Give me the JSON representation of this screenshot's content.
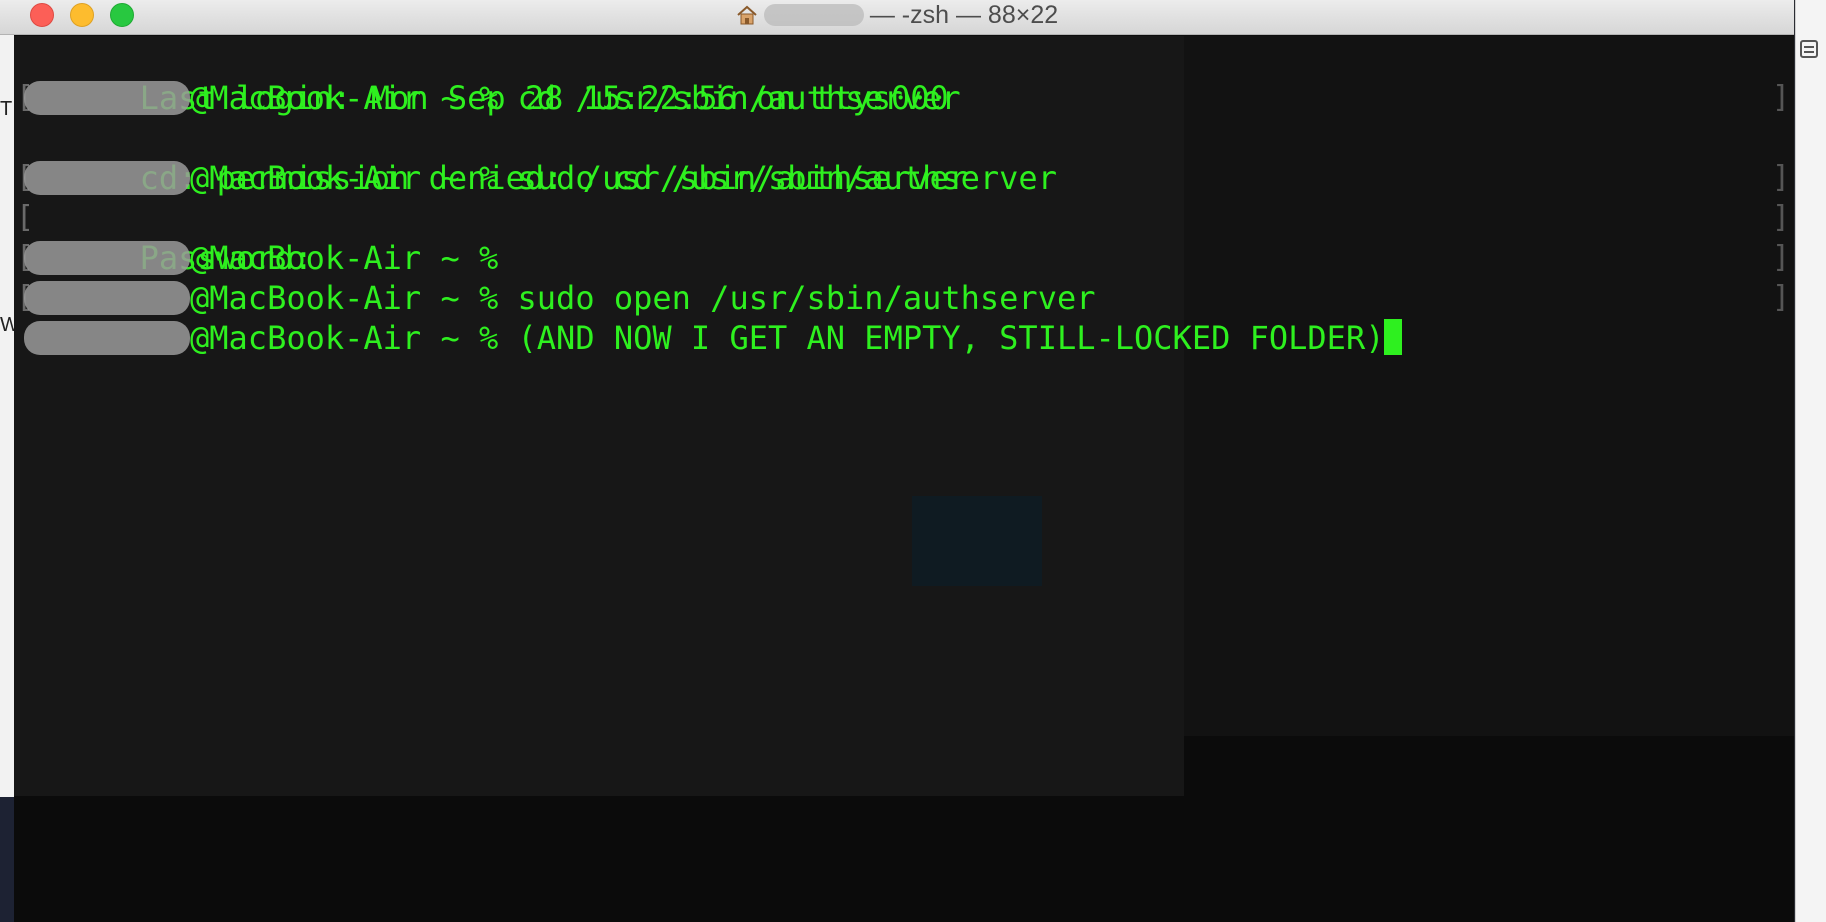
{
  "window": {
    "title": "— -zsh — 88×22",
    "icon": "home-icon"
  },
  "colors": {
    "terminal_background": "#0b0b0b",
    "terminal_text": "#2ef01f",
    "titlebar": "#e3e3e3"
  },
  "terminal": {
    "lines": [
      {
        "prompt": "",
        "text": "Last login: Mon Sep 28 15:22:56 on ttys000"
      },
      {
        "prompt": "@MacBook-Air ~ % ",
        "text": "cd /usr/sbin/authserver"
      },
      {
        "prompt": "",
        "text": "cd: permission denied: /usr/sbin/authserver"
      },
      {
        "prompt": "@MacBook-Air ~ % ",
        "text": "sudo cd /usr/sbin/authserver"
      },
      {
        "prompt": "",
        "text": "Password:"
      },
      {
        "prompt": "@MacBook-Air ~ % ",
        "text": ""
      },
      {
        "prompt": "@MacBook-Air ~ % ",
        "text": "sudo open /usr/sbin/authserver"
      },
      {
        "prompt": "@MacBook-Air ~ % ",
        "text": "(AND NOW I GET AN EMPTY, STILL-LOCKED FOLDER)"
      }
    ]
  }
}
